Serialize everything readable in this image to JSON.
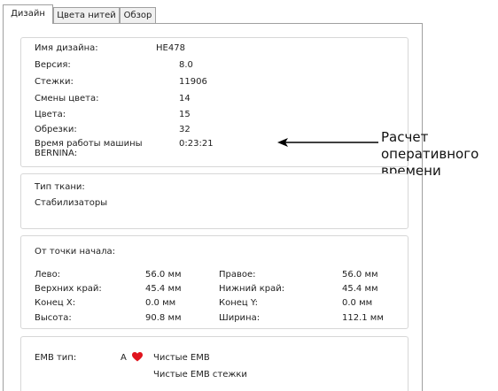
{
  "tabs": [
    {
      "label": "Дизайн",
      "active": true
    },
    {
      "label": "Цвета нитей",
      "active": false
    },
    {
      "label": "Обзор",
      "active": false
    }
  ],
  "design_info": {
    "rows": [
      {
        "label": "Имя дизайна:",
        "value": "HE478"
      },
      {
        "label": "Версия:",
        "value": "8.0"
      },
      {
        "label": "Стежки:",
        "value": "11906"
      },
      {
        "label": "Смены цвета:",
        "value": "14"
      },
      {
        "label": "Цвета:",
        "value": "15"
      },
      {
        "label": "Обрезки:",
        "value": "32"
      },
      {
        "label": "Время работы машины BERNINA:",
        "value": "0:23:21"
      }
    ]
  },
  "fabric": {
    "fabric_type_label": "Тип ткани:",
    "stabilizers_label": "Стабилизаторы"
  },
  "origin": {
    "heading": "От точки начала:",
    "rows": [
      {
        "l_label": "Лево:",
        "l_value": "56.0 мм",
        "r_label": "Правое:",
        "r_value": "56.0 мм"
      },
      {
        "l_label": "Верхних край:",
        "l_value": "45.4 мм",
        "r_label": "Нижний край:",
        "r_value": "45.4 мм"
      },
      {
        "l_label": "Конец X:",
        "l_value": "0.0 мм",
        "r_label": "Конец Y:",
        "r_value": "0.0 мм"
      },
      {
        "l_label": "Высота:",
        "l_value": "90.8 мм",
        "r_label": "Ширина:",
        "r_value": "112.1 мм"
      }
    ]
  },
  "emb": {
    "label": "EMB тип:",
    "letter": "A",
    "heart_color": "#e0141e",
    "line1": "Чистые EMB",
    "line2": "Чистые EMB стежки"
  },
  "callout": {
    "lines": [
      "Расчет",
      "оперативного",
      "времени"
    ]
  }
}
